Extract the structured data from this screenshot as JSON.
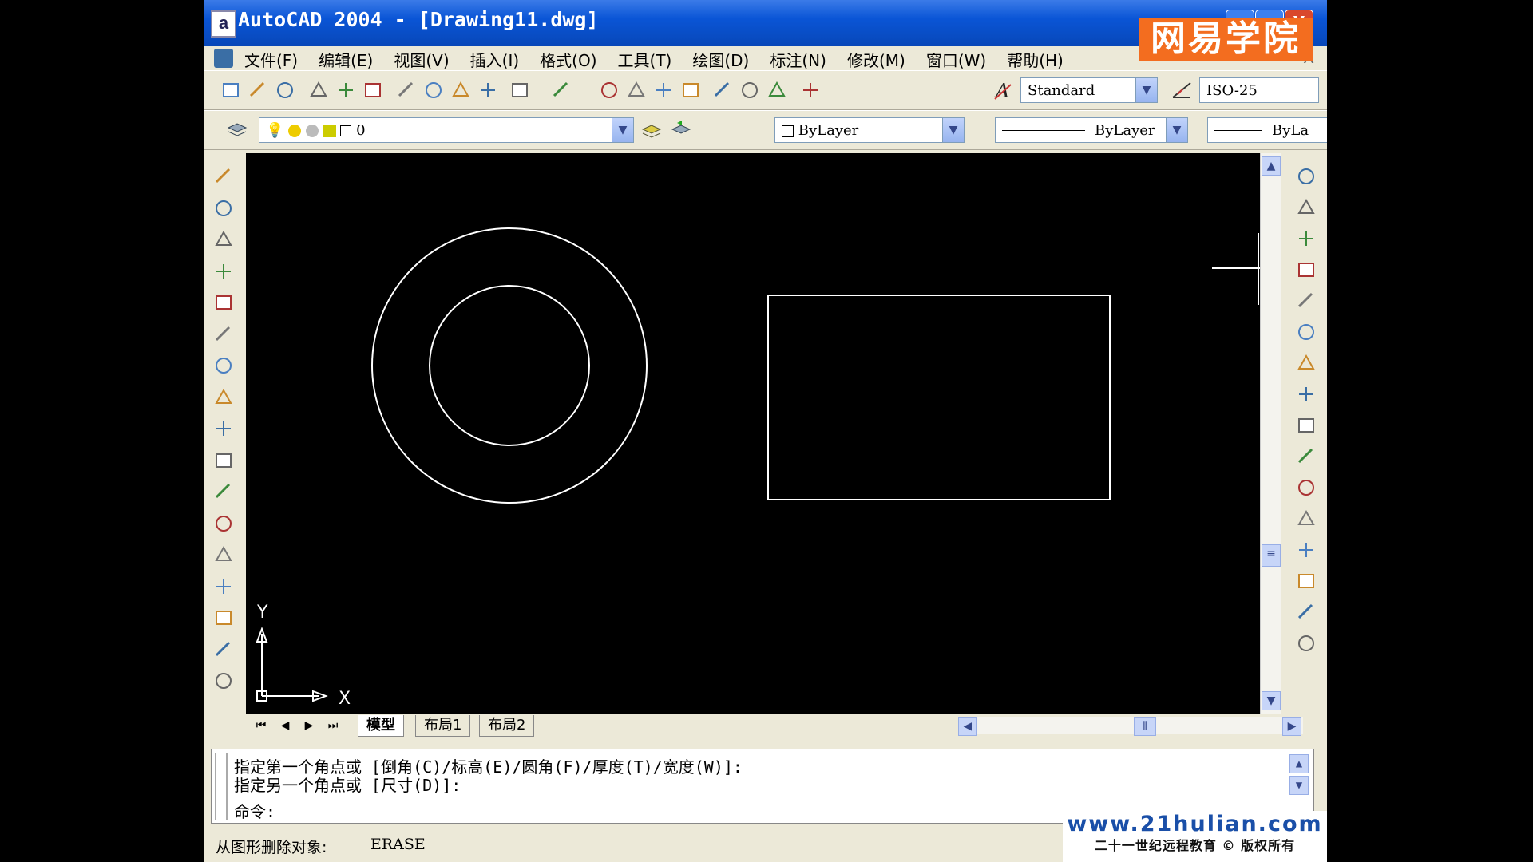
{
  "window": {
    "title": "AutoCAD 2004 - [Drawing11.dwg]",
    "app_icon": "a",
    "controls": [
      "_",
      "□",
      "X"
    ]
  },
  "watermark": {
    "brand": "网易学院",
    "url": "www.21hulian.com",
    "tagline": "二十一世纪远程教育 © 版权所有"
  },
  "menubar": {
    "items": [
      "文件(F)",
      "编辑(E)",
      "视图(V)",
      "插入(I)",
      "格式(O)",
      "工具(T)",
      "绘图(D)",
      "标注(N)",
      "修改(M)",
      "窗口(W)",
      "帮助(H)"
    ],
    "close": "X"
  },
  "toolbar": {
    "standard_icons": [
      "new-icon",
      "open-icon",
      "save-icon",
      "print-icon",
      "preview-icon",
      "publish-icon",
      "cut-icon",
      "copy-icon",
      "paste-icon",
      "matchprop-icon",
      "undo-icon",
      "redo-icon",
      "pan-icon",
      "zoom-realtime-icon",
      "zoom-window-icon",
      "zoom-previous-icon",
      "properties-icon",
      "design-center-icon",
      "tool-palettes-icon",
      "help-icon"
    ],
    "text_style": "Standard",
    "dim_style": "ISO-25"
  },
  "layers": {
    "current_layer": "0",
    "color": "ByLayer",
    "linetype": "ByLayer",
    "lineweight": "ByLa"
  },
  "draw_tools": [
    "line-icon",
    "construction-line-icon",
    "polyline-icon",
    "polygon-icon",
    "rectangle-icon",
    "arc-icon",
    "circle-icon",
    "revision-cloud-icon",
    "spline-icon",
    "ellipse-icon",
    "ellipse-arc-icon",
    "insert-block-icon",
    "make-block-icon",
    "point-icon",
    "hatch-icon",
    "region-icon",
    "multiline-text-icon"
  ],
  "modify_tools": [
    "erase-icon",
    "copy-object-icon",
    "mirror-icon",
    "offset-icon",
    "array-icon",
    "move-icon",
    "rotate-icon",
    "scale-icon",
    "stretch-icon",
    "trim-icon",
    "extend-icon",
    "break-icon",
    "join-icon",
    "chamfer-icon",
    "fillet-icon",
    "explode-icon"
  ],
  "ucs": {
    "x": "X",
    "y": "Y"
  },
  "tabs": [
    "模型",
    "布局1",
    "布局2"
  ],
  "command_line": {
    "line1": "指定第一个角点或 [倒角(C)/标高(E)/圆角(F)/厚度(T)/宽度(W)]:",
    "line2": "指定另一个角点或 [尺寸(D)]:",
    "prompt": "命令:"
  },
  "status": {
    "description": "从图形删除对象:",
    "command": "ERASE"
  },
  "colors": {
    "titlebar": "#0a55d6",
    "canvas_bg": "#000000",
    "entity": "#ffffff",
    "watermark_orange": "#f36d1f"
  }
}
